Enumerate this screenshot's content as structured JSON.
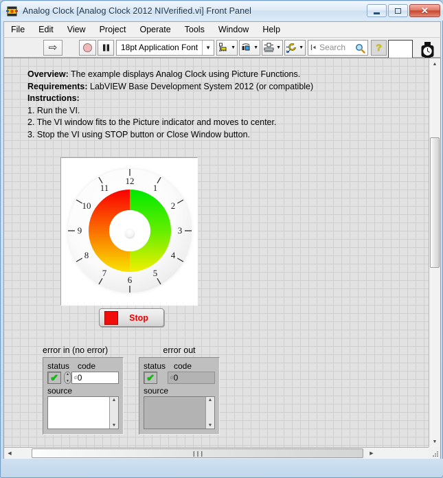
{
  "window": {
    "title": "Analog Clock [Analog Clock 2012 NIVerified.vi] Front Panel",
    "icon_name": "labview-vi-icon",
    "controls": {
      "minimize_label": "–",
      "maximize_label": "□",
      "close_label": "✕"
    }
  },
  "menubar": {
    "items": [
      {
        "label": "File"
      },
      {
        "label": "Edit"
      },
      {
        "label": "View"
      },
      {
        "label": "Project"
      },
      {
        "label": "Operate"
      },
      {
        "label": "Tools"
      },
      {
        "label": "Window"
      },
      {
        "label": "Help"
      }
    ]
  },
  "toolbar": {
    "run_label": "⇨",
    "run_name": "run-button",
    "abort_name": "abort-execution-button",
    "pause_label": "❙❙",
    "pause_name": "pause-button",
    "font_selector": {
      "value": "18pt Application Font",
      "caret": "▼"
    },
    "align_objects_name": "align-objects-button",
    "distribute_objects_name": "distribute-objects-button",
    "resize_objects_name": "resize-objects-button",
    "reorder_name": "reorder-objects-button",
    "search": {
      "placeholder": "Search",
      "icon_name": "magnifier-icon"
    },
    "help_label": "?",
    "vi_icon_name": "vi-icon-pane",
    "watch_icon_name": "wristwatch-icon"
  },
  "panel": {
    "description": {
      "lines": [
        {
          "bold": "Overview:",
          "rest": " The example displays Analog Clock using Picture Functions."
        },
        {
          "bold": "Requirements:",
          "rest": " LabVIEW Base Development System 2012 (or compatible)"
        },
        {
          "bold": "Instructions:",
          "rest": ""
        },
        {
          "bold": "",
          "rest": "1. Run the VI."
        },
        {
          "bold": "",
          "rest": "2. The VI window fits to the Picture indicator and moves to center."
        },
        {
          "bold": "",
          "rest": "3. Stop the VI using STOP button or Close Window button."
        }
      ]
    },
    "clock": {
      "indicator_name": "picture-indicator",
      "hour_numerals": [
        "12",
        "1",
        "2",
        "3",
        "4",
        "5",
        "6",
        "7",
        "8",
        "9",
        "10",
        "11"
      ],
      "ring_colors": {
        "red": "#ff0000",
        "green": "#00e000",
        "yellow": "#ffee00",
        "orange": "#ff8800",
        "yellow_green": "#c8f000"
      },
      "face_color": "#f4f4f4",
      "background": "#ffffff"
    },
    "stop_button": {
      "label": "Stop",
      "led_color": "#f20d0d"
    },
    "error_in": {
      "title": "error in (no error)",
      "status_label": "status",
      "code_label": "code",
      "source_label": "source",
      "status_value": "✔",
      "code_value": "0",
      "source_value": "",
      "code_prefix": "d"
    },
    "error_out": {
      "title": "error out",
      "status_label": "status",
      "code_label": "code",
      "source_label": "source",
      "status_value": "✔",
      "code_value": "0",
      "source_value": "",
      "code_prefix": "d"
    }
  },
  "scrollbars": {
    "up_arrow": "▲",
    "down_arrow": "▼",
    "left_arrow": "◀",
    "right_arrow": "▶",
    "grip": "❙❙❙"
  }
}
